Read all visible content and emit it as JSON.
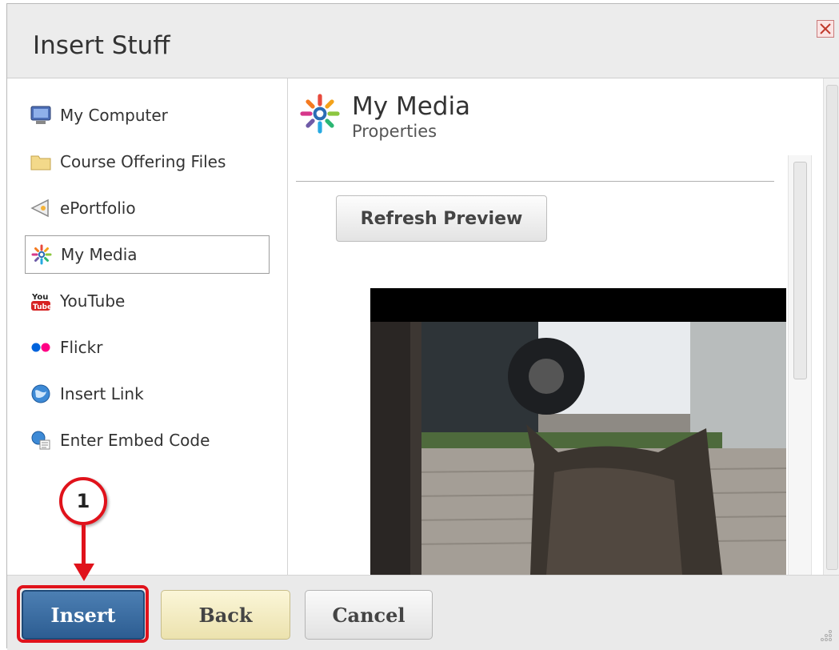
{
  "dialog": {
    "title": "Insert Stuff"
  },
  "sidebar": {
    "items": [
      {
        "label": "My Computer",
        "icon": "computer-icon"
      },
      {
        "label": "Course Offering Files",
        "icon": "folder-icon"
      },
      {
        "label": "ePortfolio",
        "icon": "eportfolio-icon"
      },
      {
        "label": "My Media",
        "icon": "my-media-icon",
        "selected": true
      },
      {
        "label": "YouTube",
        "icon": "youtube-icon"
      },
      {
        "label": "Flickr",
        "icon": "flickr-icon"
      },
      {
        "label": "Insert Link",
        "icon": "globe-icon"
      },
      {
        "label": "Enter Embed Code",
        "icon": "embed-code-icon"
      }
    ]
  },
  "main": {
    "title": "My Media",
    "subtitle": "Properties",
    "refresh_label": "Refresh Preview"
  },
  "footer": {
    "insert_label": "Insert",
    "back_label": "Back",
    "cancel_label": "Cancel"
  },
  "annotation": {
    "step_number": "1"
  },
  "colors": {
    "accent": "#2d5d92",
    "annotation_red": "#e0121b",
    "back_button": "#f3ecc3"
  }
}
